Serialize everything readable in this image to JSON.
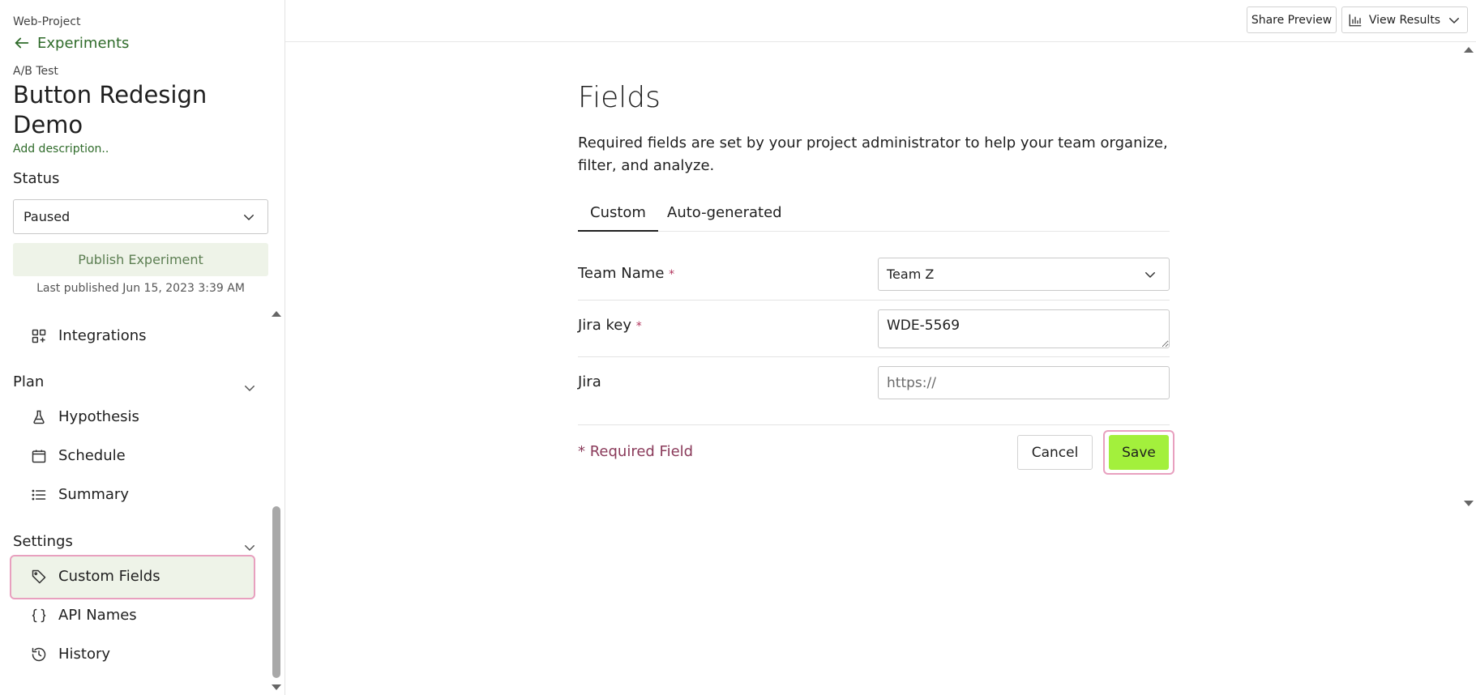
{
  "sidebar": {
    "project": "Web-Project",
    "back_label": "Experiments",
    "type_label": "A/B Test",
    "experiment_title": "Button Redesign Demo",
    "add_description": "Add description..",
    "status_label": "Status",
    "status_value": "Paused",
    "publish_label": "Publish Experiment",
    "last_published": "Last published Jun 15, 2023 3:39 AM",
    "nav": {
      "integrations": "Integrations",
      "plan_heading": "Plan",
      "hypothesis": "Hypothesis",
      "schedule": "Schedule",
      "summary": "Summary",
      "settings_heading": "Settings",
      "custom_fields": "Custom Fields",
      "api_names": "API Names",
      "history": "History"
    }
  },
  "header": {
    "share_preview": "Share Preview",
    "view_results": "View Results"
  },
  "main": {
    "title": "Fields",
    "description": "Required fields are set by your project administrator to help your team organize, filter, and analyze.",
    "tabs": [
      {
        "label": "Custom",
        "active": true
      },
      {
        "label": "Auto-generated",
        "active": false
      }
    ],
    "fields": {
      "team_name": {
        "label": "Team Name",
        "required_mark": "*",
        "value": "Team Z"
      },
      "jira_key": {
        "label": "Jira key",
        "required_mark": "*",
        "value": "WDE-5569"
      },
      "jira": {
        "label": "Jira",
        "placeholder": "https://"
      }
    },
    "required_note": "* Required Field",
    "cancel_label": "Cancel",
    "save_label": "Save"
  },
  "colors": {
    "accent_green": "#2f6b2a",
    "save_green": "#a3f03c",
    "highlight_pink": "#e8a0bf",
    "required_red": "#b0325a"
  }
}
